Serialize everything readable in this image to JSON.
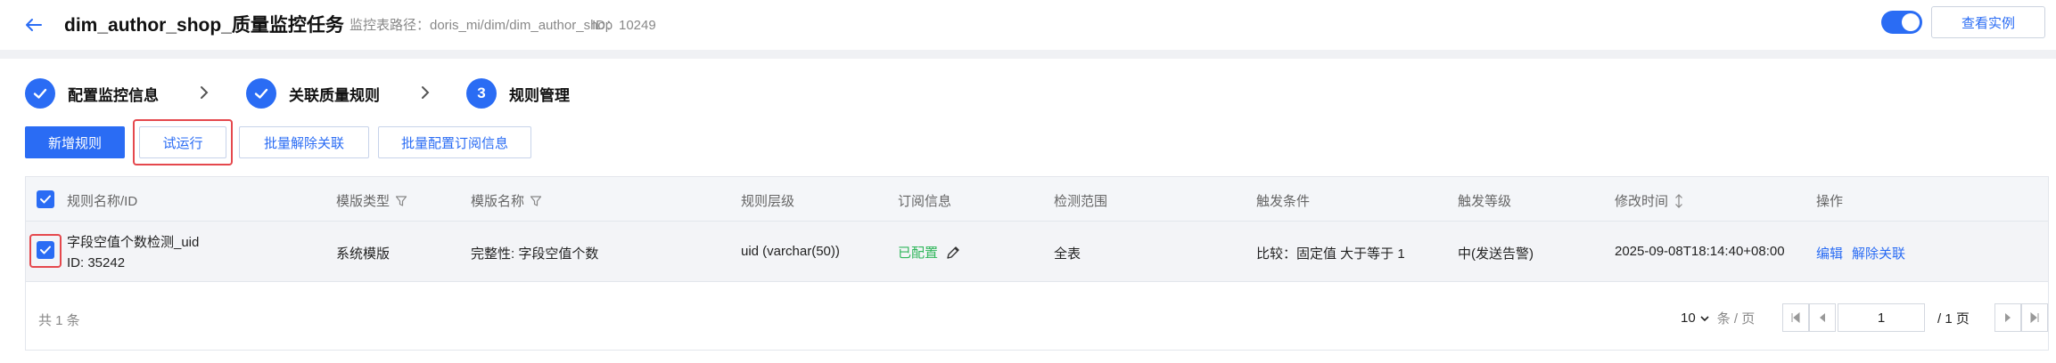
{
  "header": {
    "title": "dim_author_shop_质量监控任务",
    "path_label": "监控表路径：doris_mi/dim/dim_author_shop",
    "id_label": "ID：10249",
    "toggle_on": true,
    "view_instance_label": "查看实例",
    "accent": "#2a6cf4"
  },
  "steps": [
    {
      "label": "配置监控信息",
      "state": "done",
      "icon": "check-icon"
    },
    {
      "label": "关联质量规则",
      "state": "done",
      "icon": "check-icon"
    },
    {
      "number": "3",
      "label": "规则管理",
      "state": "current"
    }
  ],
  "actions": {
    "add_rule": "新增规则",
    "trial_run": "试运行",
    "batch_unlink": "批量解除关联",
    "batch_subscribe": "批量配置订阅信息"
  },
  "table": {
    "columns": [
      "规则名称/ID",
      "模版类型",
      "模版名称",
      "规则层级",
      "订阅信息",
      "检测范围",
      "触发条件",
      "触发等级",
      "修改时间",
      "操作"
    ],
    "rows": [
      {
        "name": "字段空值个数检测_uid",
        "id": "ID: 35242",
        "template_type": "系统模版",
        "template_name": "完整性: 字段空值个数",
        "level": "uid (varchar(50))",
        "subscription": "已配置",
        "scope": "全表",
        "condition": "比较：固定值 大于等于 1",
        "trigger_level": "中(发送告警)",
        "modified_time": "2025-09-08T18:14:40+08:00",
        "op_edit": "编辑",
        "op_unlink": "解除关联",
        "checked": true
      }
    ]
  },
  "pagination": {
    "total": "共 1 条",
    "page_size": "10",
    "page_size_unit": "条 / 页",
    "current_page": "1",
    "total_pages": "/ 1 页"
  },
  "colors": {
    "primary": "#2a6cf4",
    "success": "#2fb65b",
    "highlight": "#e5484d"
  }
}
